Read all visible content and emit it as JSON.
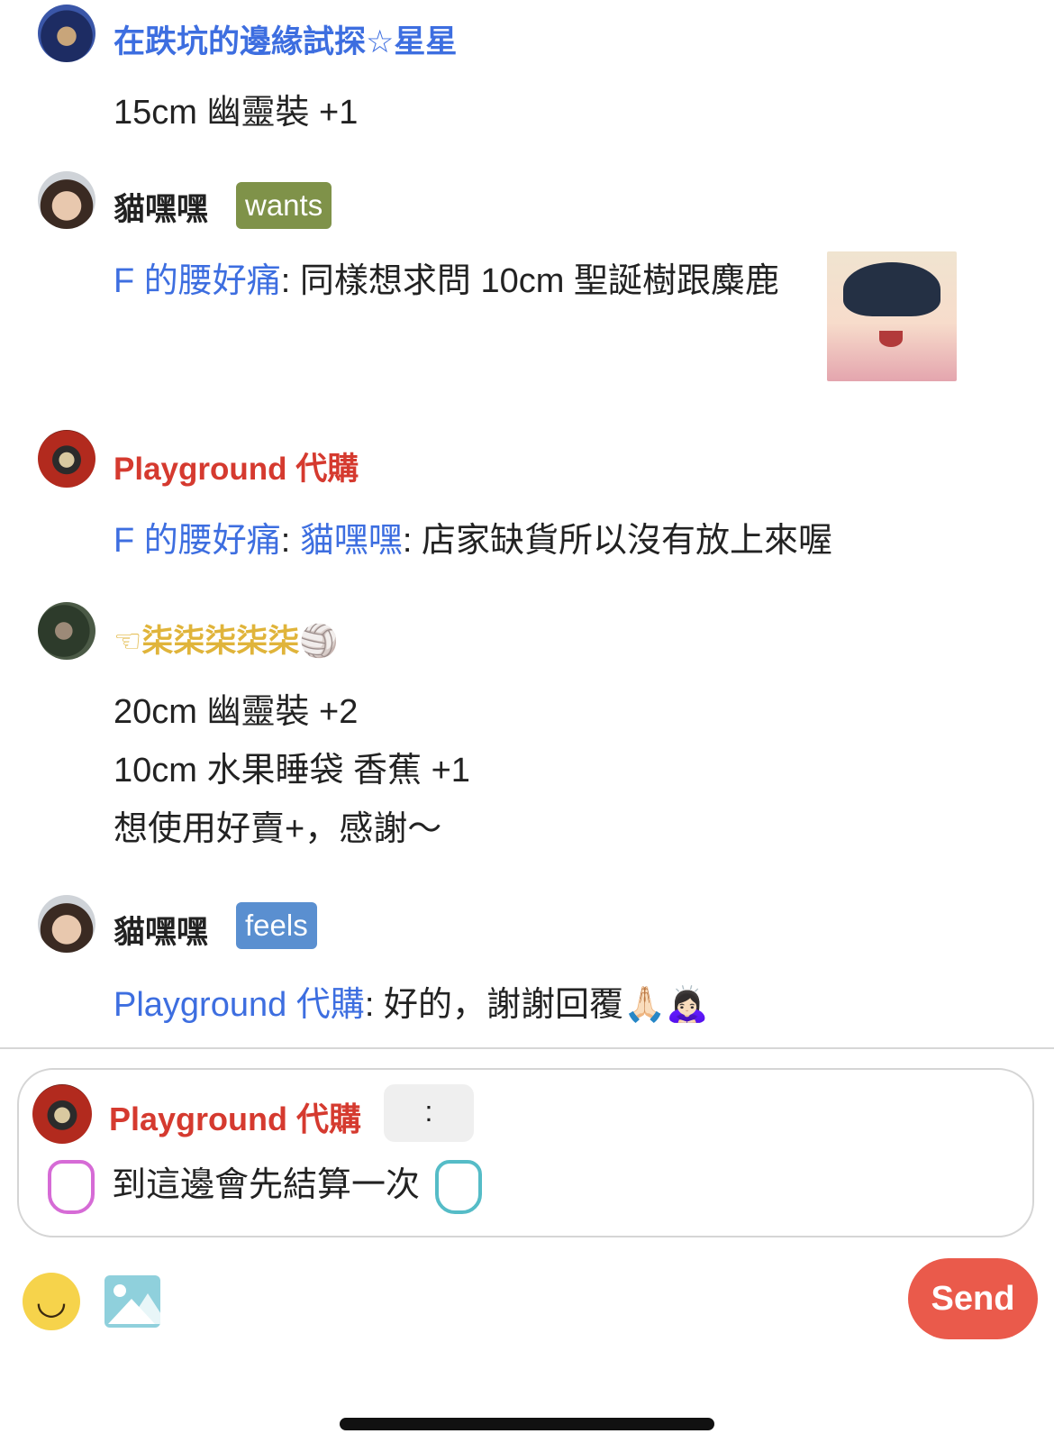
{
  "messages": [
    {
      "user": "在跌坑的邊緣試探☆星星",
      "lines": [
        "15cm 幽靈裝 +1"
      ]
    },
    {
      "user": "貓嘿嘿",
      "tag": "wants",
      "reply_to": "F 的腰好痛",
      "text": "同樣想求問 10cm 聖誕樹跟麋鹿"
    },
    {
      "user": "Playground 代購",
      "reply_to": "F 的腰好痛",
      "reply_to_2": "貓嘿嘿",
      "text": "店家缺貨所以沒有放上來喔"
    },
    {
      "user": "☜柒柒柒柒柒",
      "user_emoji": "🏐",
      "lines": [
        "20cm 幽靈裝 +2",
        "10cm 水果睡袋 香蕉 +1",
        "想使用好賣+，感謝～"
      ]
    },
    {
      "user": "貓嘿嘿",
      "tag": "feels",
      "reply_to": "Playground 代購",
      "text": "好的，謝謝回覆🙏🏻🙇🏻‍♀️"
    }
  ],
  "reply_box": {
    "user": "Playground 代購",
    "more": ":",
    "text": "到這邊會先結算一次"
  },
  "toolbar": {
    "emoji_icon": "smile-icon",
    "image_icon": "image-icon",
    "send_label": "Send"
  }
}
